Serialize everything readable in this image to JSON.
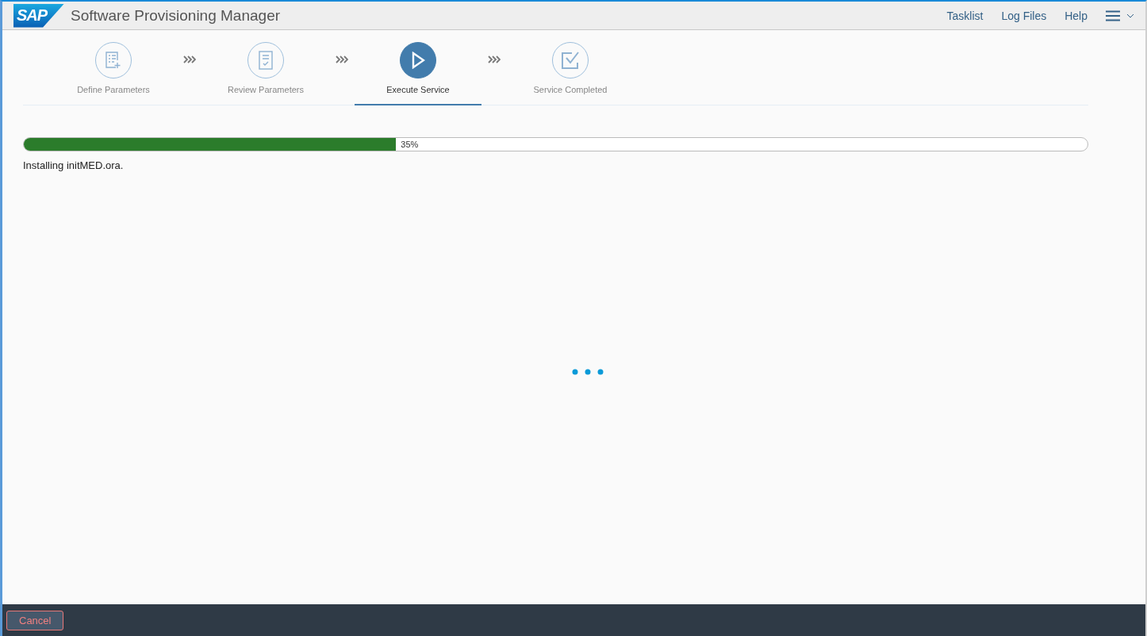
{
  "header": {
    "logo": "SAP",
    "title": "Software Provisioning Manager",
    "links": [
      "Tasklist",
      "Log Files",
      "Help"
    ]
  },
  "steps": [
    {
      "label": "Define Parameters",
      "kind": "define",
      "selected": false
    },
    {
      "label": "Review Parameters",
      "kind": "review",
      "selected": false
    },
    {
      "label": "Execute Service",
      "kind": "execute",
      "selected": true
    },
    {
      "label": "Service Completed",
      "kind": "completed",
      "selected": false
    }
  ],
  "progress": {
    "level": 0.35,
    "reading": "35%",
    "message": "Installing initMED.ora."
  },
  "footer": {
    "buttons": [
      "Cancel"
    ]
  }
}
